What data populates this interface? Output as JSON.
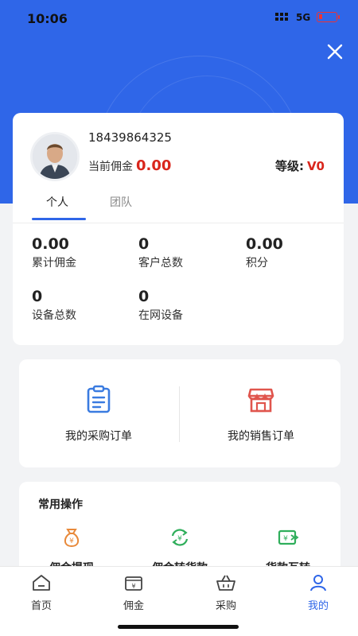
{
  "status": {
    "time": "10:06",
    "network": "5G"
  },
  "colors": {
    "primary": "#2f66e8",
    "accent_red": "#d9261c"
  },
  "profile": {
    "phone": "18439864325",
    "commission_label": "当前佣金",
    "commission_value": "0.00",
    "level_label": "等级:",
    "level_value": "V0"
  },
  "tabs": [
    {
      "label": "个人",
      "active": true
    },
    {
      "label": "团队",
      "active": false
    }
  ],
  "stats": [
    {
      "value": "0.00",
      "label": "累计佣金"
    },
    {
      "value": "0",
      "label": "客户总数"
    },
    {
      "value": "0.00",
      "label": "积分"
    },
    {
      "value": "0",
      "label": "设备总数"
    },
    {
      "value": "0",
      "label": "在网设备"
    }
  ],
  "orders": [
    {
      "label": "我的采购订单",
      "icon": "clipboard-icon"
    },
    {
      "label": "我的销售订单",
      "icon": "store-icon"
    }
  ],
  "ops": {
    "title": "常用操作",
    "items": [
      {
        "label": "佣金提现",
        "icon": "money-bag-icon"
      },
      {
        "label": "佣金转货款",
        "icon": "exchange-icon"
      },
      {
        "label": "货款互转",
        "icon": "transfer-icon"
      }
    ]
  },
  "tabbar": [
    {
      "label": "首页",
      "icon": "home-icon",
      "active": false
    },
    {
      "label": "佣金",
      "icon": "wallet-icon",
      "active": false
    },
    {
      "label": "采购",
      "icon": "basket-icon",
      "active": false
    },
    {
      "label": "我的",
      "icon": "user-icon",
      "active": true
    }
  ]
}
